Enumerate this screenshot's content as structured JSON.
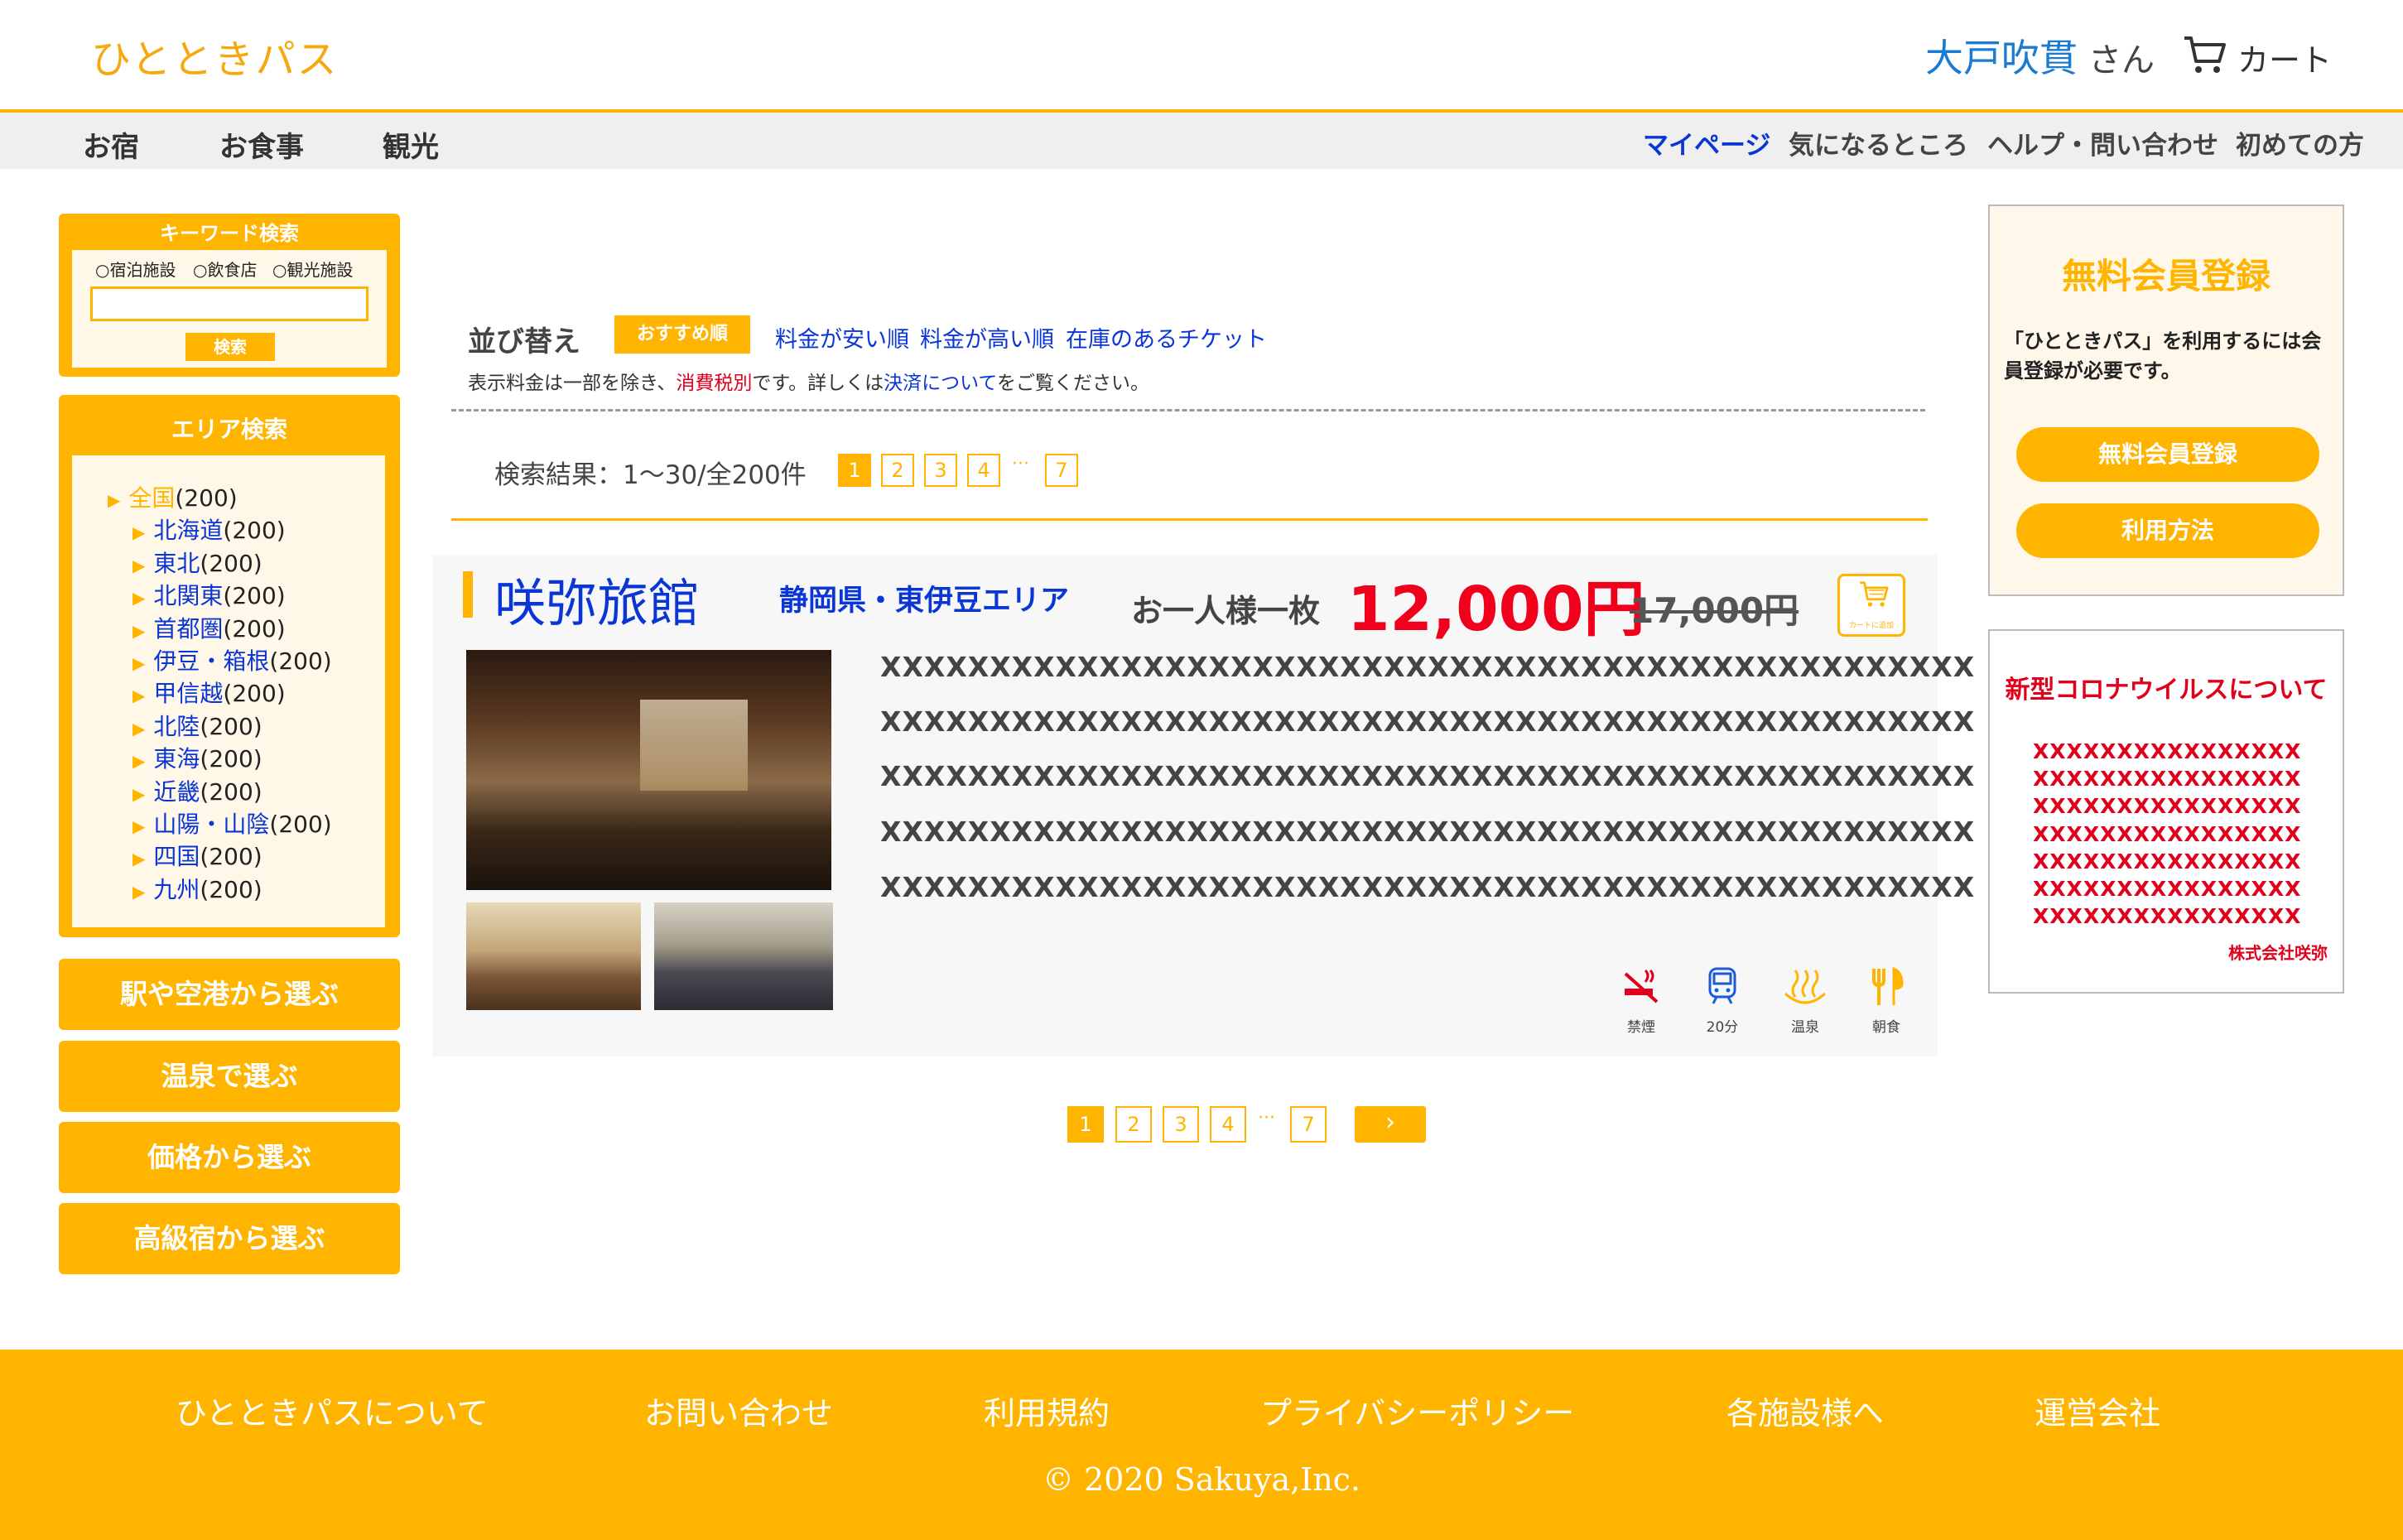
{
  "header": {
    "logo": "ひとときパス",
    "user_name": "大戸吹貫",
    "user_suffix": "さん",
    "cart_label": "カート"
  },
  "nav": {
    "left": [
      "お宿",
      "お食事",
      "観光"
    ],
    "right": [
      "マイページ",
      "気になるところ",
      "ヘルプ・問い合わせ",
      "初めての方"
    ]
  },
  "keyword_search": {
    "title": "キーワード検索",
    "options": [
      "宿泊施設",
      "飲食店",
      "観光施設"
    ],
    "input_value": "",
    "button": "検索"
  },
  "area_search": {
    "title": "エリア検索",
    "items": [
      {
        "name": "全国",
        "count": "(200)"
      },
      {
        "name": "北海道",
        "count": "(200)"
      },
      {
        "name": "東北",
        "count": "(200)"
      },
      {
        "name": "北関東",
        "count": "(200)"
      },
      {
        "name": "首都圏",
        "count": "(200)"
      },
      {
        "name": "伊豆・箱根",
        "count": "(200)"
      },
      {
        "name": "甲信越",
        "count": "(200)"
      },
      {
        "name": "北陸",
        "count": "(200)"
      },
      {
        "name": "東海",
        "count": "(200)"
      },
      {
        "name": "近畿",
        "count": "(200)"
      },
      {
        "name": "山陽・山陰",
        "count": "(200)"
      },
      {
        "name": "四国",
        "count": "(200)"
      },
      {
        "name": "九州",
        "count": "(200)"
      }
    ]
  },
  "side_buttons": [
    "駅や空港から選ぶ",
    "温泉で選ぶ",
    "価格から選ぶ",
    "高級宿から選ぶ"
  ],
  "sort": {
    "label": "並び替え",
    "active": "おすすめ順",
    "options": [
      "料金が安い順",
      "料金が高い順",
      "在庫のあるチケット"
    ]
  },
  "tax_note": {
    "pre": "表示料金は一部を除き、",
    "tax": "消費税別",
    "mid": "です。詳しくは",
    "link": "決済について",
    "post": "をご覧ください。"
  },
  "results": {
    "text": "検索結果：1〜30/全200件",
    "pages": [
      "1",
      "2",
      "3",
      "4"
    ],
    "ellipsis": "···",
    "last_page": "7",
    "current_page": "1",
    "next": "›"
  },
  "listing": {
    "name": "咲弥旅館",
    "area": "静岡県・東伊豆エリア",
    "per_person": "お一人様一枚",
    "price": "12,000円",
    "old_price": "17,000円",
    "cart_add_label": "カートに追加",
    "description": [
      "XXXXXXXXXXXXXXXXXXXXXXXXXXXXXXXXXXXXXXXXXXXXXXXXXX",
      "XXXXXXXXXXXXXXXXXXXXXXXXXXXXXXXXXXXXXXXXXXXXXXXXXX",
      "XXXXXXXXXXXXXXXXXXXXXXXXXXXXXXXXXXXXXXXXXXXXXXXXXX",
      "XXXXXXXXXXXXXXXXXXXXXXXXXXXXXXXXXXXXXXXXXXXXXXXXXX",
      "XXXXXXXXXXXXXXXXXXXXXXXXXXXXXXXXXXXXXXXXXXXXXXXXXX"
    ],
    "features": [
      {
        "icon": "no-smoking-icon",
        "label": "禁煙"
      },
      {
        "icon": "train-icon",
        "label": "20分"
      },
      {
        "icon": "hot-spring-icon",
        "label": "温泉"
      },
      {
        "icon": "fork-knife-icon",
        "label": "朝食"
      }
    ]
  },
  "register": {
    "title": "無料会員登録",
    "desc": "「ひとときパス」を利用するには会員登録が必要です。",
    "buttons": [
      "無料会員登録",
      "利用方法"
    ]
  },
  "covid": {
    "title": "新型コロナウイルスについて",
    "lines": [
      "XXXXXXXXXXXXXXXX",
      "XXXXXXXXXXXXXXXX",
      "XXXXXXXXXXXXXXXX",
      "XXXXXXXXXXXXXXXX",
      "XXXXXXXXXXXXXXXX",
      "XXXXXXXXXXXXXXXX",
      "XXXXXXXXXXXXXXXX"
    ],
    "company": "株式会社咲弥"
  },
  "footer": {
    "links": [
      "ひとときパスについて",
      "お問い合わせ",
      "利用規約",
      "プライバシーポリシー",
      "各施設様へ",
      "運営会社"
    ],
    "copyright": "© 2020 Sakuya,Inc."
  },
  "colors": {
    "accent": "#FFB400",
    "link": "#0A36D6",
    "price": "#F0001B"
  }
}
